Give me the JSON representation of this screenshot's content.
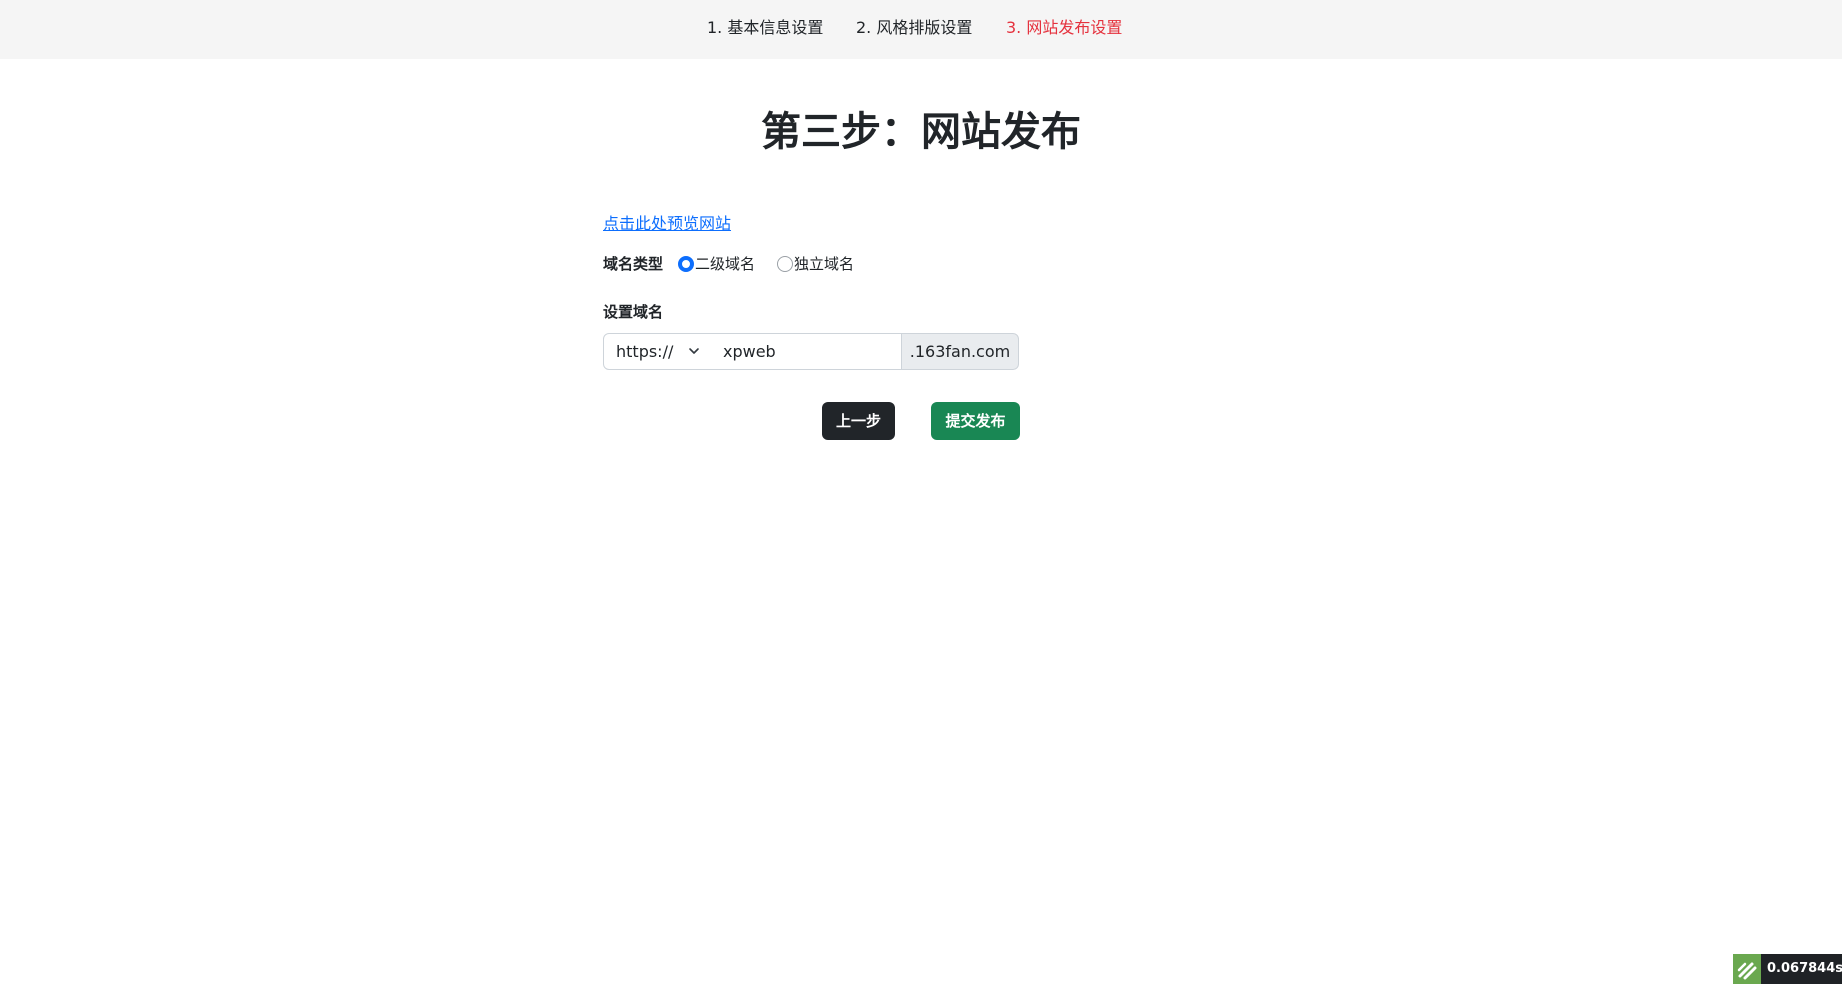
{
  "nav": {
    "steps": [
      {
        "label": "1. 基本信息设置"
      },
      {
        "label": "2. 风格排版设置"
      },
      {
        "label": "3. 网站发布设置"
      }
    ],
    "active_color": "#e5323e"
  },
  "main": {
    "title": "第三步：网站发布",
    "preview_link": "点击此处预览网站",
    "domain_type": {
      "label": "域名类型",
      "options": [
        "二级域名",
        "独立域名"
      ],
      "selected": "二级域名"
    },
    "set_domain": {
      "label": "设置域名",
      "protocol": "https://",
      "subdomain_value": "xpweb",
      "suffix": ".163fan.com"
    },
    "buttons": {
      "prev": "上一步",
      "submit": "提交发布"
    }
  },
  "debug_badge": {
    "time": "0.067844s",
    "icon": "thinkphp-logo-icon"
  },
  "colors": {
    "primary": "#0d6efd",
    "dark_button": "#212529",
    "success_button": "#198754"
  }
}
